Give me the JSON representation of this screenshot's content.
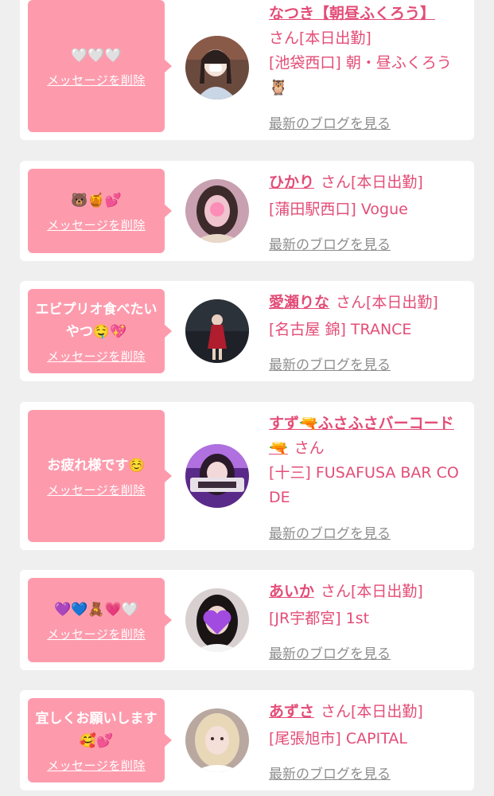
{
  "delete_label": "メッセージを削除",
  "blog_label": "最新のブログを見る",
  "items": [
    {
      "message": "🤍🤍🤍",
      "name": "なつき【朝昼ふくろう】",
      "status": "さん[本日出勤]",
      "shop": "[池袋西口] 朝・昼ふくろう🦉"
    },
    {
      "message": "🐻🍯💕",
      "name": "ひかり",
      "status": "さん[本日出勤]",
      "shop": "[蒲田駅西口] Vogue"
    },
    {
      "message": "エビプリオ食べたいやつ🤤💖",
      "name": "愛瀬りな",
      "status": "さん[本日出勤]",
      "shop": "[名古屋 錦] TRANCE"
    },
    {
      "message": "お疲れ様です☺️",
      "name": "すず🔫ふさふさバーコード🔫",
      "status": "さん",
      "shop": "[十三] FUSAFUSA BAR CODE"
    },
    {
      "message": "💜💙🧸💗🤍",
      "name": "あいか",
      "status": "さん[本日出勤]",
      "shop": "[JR宇都宮] 1st"
    },
    {
      "message": "宜しくお願いします🥰💕",
      "name": "あずさ",
      "status": "さん[本日出勤]",
      "shop": "[尾張旭市] CAPITAL"
    }
  ],
  "colors": {
    "background": "#efeff0",
    "bubble": "#fd9bad",
    "name": "#e34d77",
    "blog_link": "#8e8e8e"
  }
}
